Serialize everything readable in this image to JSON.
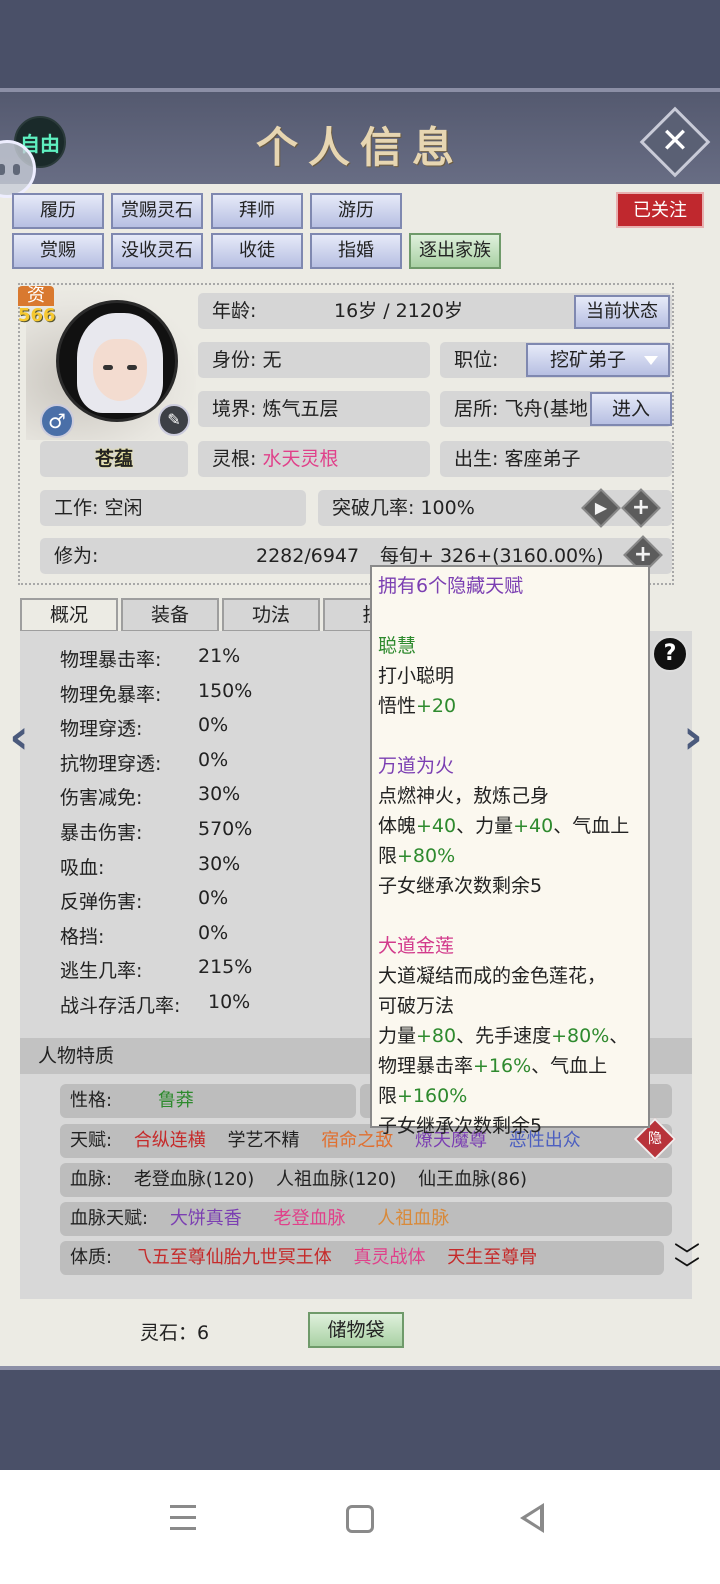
{
  "header": {
    "title": "个人信息",
    "mode_badge": "自由",
    "followed_badge": "已关注"
  },
  "actions": {
    "row1": [
      "履历",
      "赏赐灵石",
      "拜师",
      "游历"
    ],
    "row2": [
      "赏赐",
      "没收灵石",
      "收徒",
      "指婚",
      "逐出家族"
    ]
  },
  "profile": {
    "zi_label": "资",
    "zi_value": "566",
    "name": "苍蕴",
    "age_label": "年龄:",
    "age_value": "16岁 / 2120岁",
    "state_button": "当前状态",
    "identity_label": "身份:",
    "identity_value": "无",
    "position_label": "职位:",
    "position_value": "挖矿弟子",
    "realm_label": "境界:",
    "realm_value": "炼气五层",
    "residence_label": "居所:",
    "residence_value": "飞舟(基地",
    "enter_button": "进入",
    "root_label": "灵根:",
    "root_value": "水天灵根",
    "birth_label": "出生:",
    "birth_value": "客座弟子",
    "work_label": "工作:",
    "work_value": "空闲",
    "breakthrough_label": "突破几率:",
    "breakthrough_value": "100%",
    "cultivation_label": "修为:",
    "cultivation_value": "2282/6947",
    "cultivation_rate": "每旬+  326+(3160.00%)"
  },
  "tabs": [
    "概况",
    "装备",
    "功法",
    "技"
  ],
  "stats": [
    {
      "label": "物理暴击率:",
      "value": "21%"
    },
    {
      "label": "物理免暴率:",
      "value": "150%"
    },
    {
      "label": "物理穿透:",
      "value": "0%"
    },
    {
      "label": "抗物理穿透:",
      "value": "0%"
    },
    {
      "label": "伤害减免:",
      "value": "30%"
    },
    {
      "label": "暴击伤害:",
      "value": "570%"
    },
    {
      "label": "吸血:",
      "value": "30%"
    },
    {
      "label": "反弹伤害:",
      "value": "0%"
    },
    {
      "label": "格挡:",
      "value": "0%"
    },
    {
      "label": "逃生几率:",
      "value": "215%"
    },
    {
      "label": "战斗存活几率:",
      "value": "10%"
    }
  ],
  "traits": {
    "section_title": "人物特质",
    "personality_label": "性格:",
    "personality_value": "鲁莽",
    "talent_label": "天赋:",
    "talent_values": [
      "合纵连横",
      "学艺不精",
      "宿命之敌",
      "燎天魔尊",
      "恶性出众"
    ],
    "bloodline_label": "血脉:",
    "bloodline_values": [
      "老登血脉(120)",
      "人祖血脉(120)",
      "仙王血脉(86)"
    ],
    "blood_talent_label": "血脉天赋:",
    "blood_talent_values": [
      "大饼真香",
      "老登血脉",
      "人祖血脉"
    ],
    "physique_label": "体质:",
    "physique_values": [
      "乁五至尊仙胎九世冥王体",
      "真灵战体",
      "天生至尊骨"
    ],
    "hidden_tag": "隐"
  },
  "tooltip": {
    "title": "拥有6个隐藏天赋",
    "t1_name": "聪慧",
    "t1_desc": "打小聪明",
    "t1_stat_prefix": "悟性",
    "t1_stat_value": "+20",
    "t2_name": "万道为火",
    "t2_desc": "点燃神火，敖炼己身",
    "t2_l1_a": "体魄",
    "t2_l1_b": "+40",
    "t2_l1_c": "、力量",
    "t2_l1_d": "+40",
    "t2_l1_e": "、气血上",
    "t2_l2_a": "限",
    "t2_l2_b": "+80%",
    "t2_inherit": "子女继承次数剩余5",
    "t3_name": "大道金莲",
    "t3_desc1": "大道凝结而成的金色莲花，",
    "t3_desc2": "可破万法",
    "t3_l1_a": "力量",
    "t3_l1_b": "+80",
    "t3_l1_c": "、先手速度",
    "t3_l1_d": "+80%",
    "t3_l1_e": "、",
    "t3_l2_a": "物理暴击率",
    "t3_l2_b": "+16%",
    "t3_l2_c": "、气血上",
    "t3_l3_a": "限",
    "t3_l3_b": "+160%",
    "t3_inherit": "子女继承次数剩余5"
  },
  "footer": {
    "spirit_stone": "灵石：6",
    "bag_button": "储物袋"
  },
  "colors": {
    "panel_bg": "#ecebe4",
    "frame_bg": "#4a5068",
    "button_blue": "#b7bfe2",
    "button_green": "#a9d1a4",
    "badge_red": "#c0282e"
  }
}
